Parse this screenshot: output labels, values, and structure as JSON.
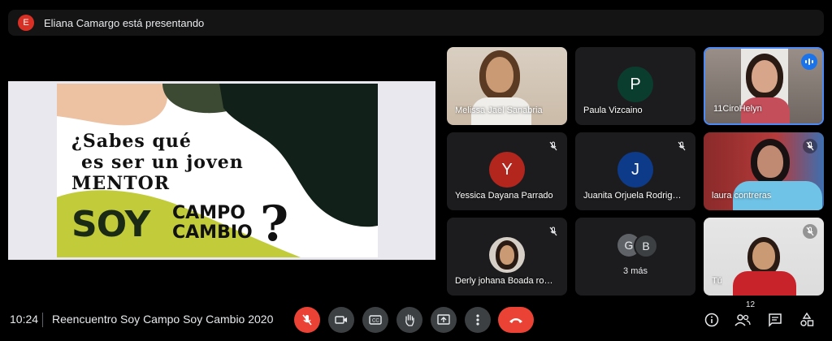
{
  "topbar": {
    "avatar_letter": "E",
    "presenting_text": "Eliana Camargo está presentando"
  },
  "slide": {
    "line1": "¿Sabes qué",
    "line2": "es ser un joven",
    "line3": "MENTOR",
    "soy": "SOY",
    "campo": "CAMPO",
    "cambio": "CAMBIO",
    "question": "?"
  },
  "participants": [
    {
      "name": "Melissa Jaël Sanabria",
      "type": "video",
      "muted": false
    },
    {
      "name": "Paula Vizcaino",
      "type": "avatar",
      "letter": "P",
      "color": "#0b3d2e",
      "muted": false
    },
    {
      "name": "11CiroHelyn",
      "type": "video",
      "muted": false,
      "speaking": true
    },
    {
      "name": "Yessica Dayana Parrado",
      "type": "avatar",
      "letter": "Y",
      "color": "#b3261e",
      "muted": true
    },
    {
      "name": "Juanita Orjuela Rodrig…",
      "type": "avatar",
      "letter": "J",
      "color": "#0d3b8a",
      "muted": true
    },
    {
      "name": "laura contreras",
      "type": "video",
      "muted": true
    },
    {
      "name": "Derly johana Boada ro…",
      "type": "video-small",
      "muted": true
    },
    {
      "name": "3 más",
      "type": "more",
      "letters": [
        "G",
        "B"
      ],
      "muted": false
    },
    {
      "name": "Tú",
      "type": "video",
      "muted": true
    }
  ],
  "bottombar": {
    "time": "10:24",
    "meeting_title": "Reencuentro Soy Campo Soy Cambio 2020",
    "participants_count": "12"
  },
  "colors": {
    "accent_blue": "#1a73e8",
    "danger_red": "#ea4335",
    "active_border": "#4c8bf5"
  },
  "icons": [
    "mic-off-icon",
    "camera-icon",
    "captions-icon",
    "raise-hand-icon",
    "present-icon",
    "more-options-icon",
    "hangup-icon",
    "info-icon",
    "people-icon",
    "chat-icon",
    "activities-icon"
  ]
}
